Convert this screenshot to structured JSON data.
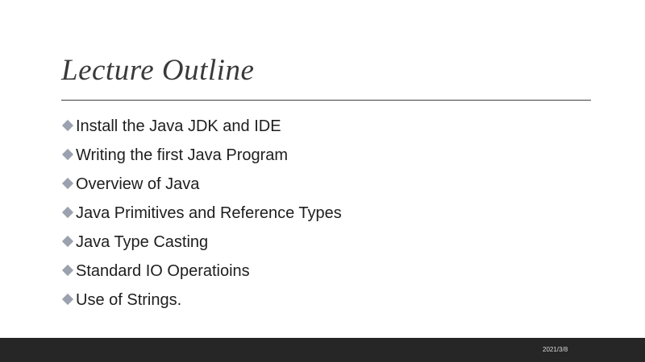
{
  "slide": {
    "title": "Lecture Outline",
    "bullets": [
      "Install the Java JDK and IDE",
      "Writing the first Java Program",
      "Overview of Java",
      "Java Primitives and Reference Types",
      "Java Type Casting",
      "Standard IO Operatioins",
      "Use of Strings."
    ],
    "bullet_icon": "diamond-bullet-icon",
    "bullet_color": "#9ba1ae"
  },
  "footer": {
    "date": "2021/3/8",
    "background_color": "#262626"
  }
}
